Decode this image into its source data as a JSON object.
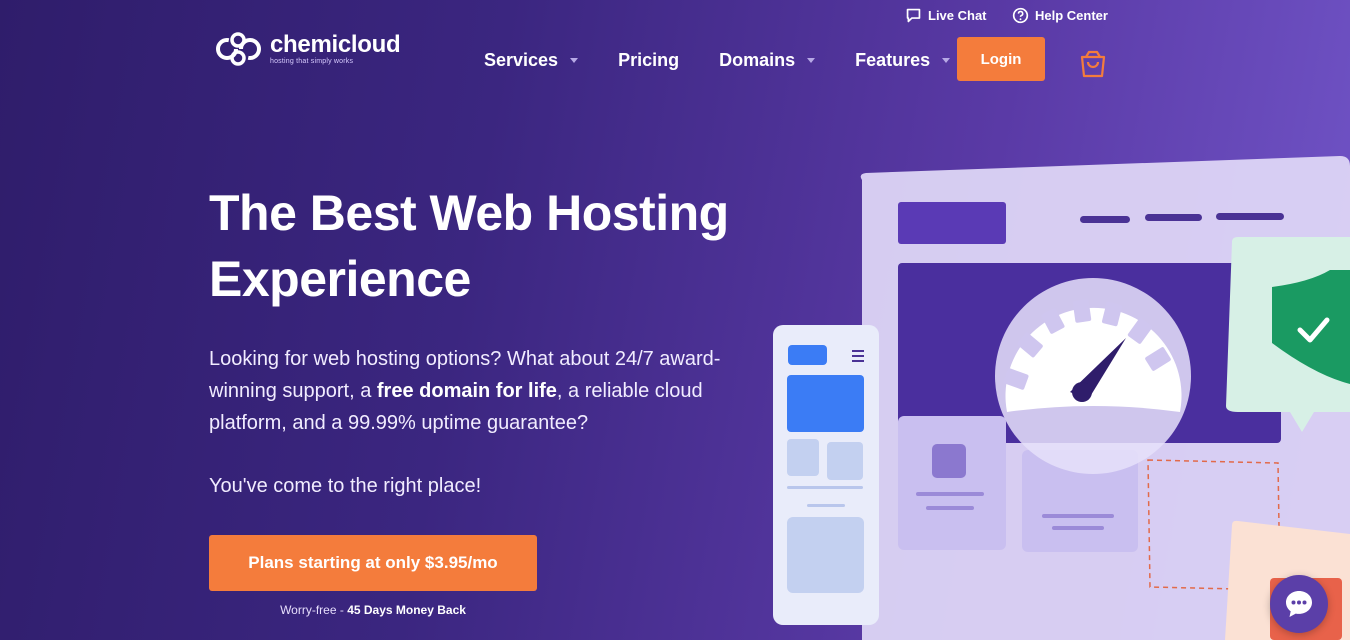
{
  "utility": {
    "live_chat": "Live Chat",
    "help_center": "Help Center"
  },
  "logo": {
    "name": "chemicloud",
    "tagline": "hosting that simply works"
  },
  "nav": {
    "items": [
      {
        "label": "Services",
        "has_dropdown": true
      },
      {
        "label": "Pricing",
        "has_dropdown": false
      },
      {
        "label": "Domains",
        "has_dropdown": true
      },
      {
        "label": "Features",
        "has_dropdown": true
      }
    ],
    "login_label": "Login"
  },
  "hero": {
    "title": "The Best Web Hosting Experience",
    "desc_part1": "Looking for web hosting options? What about 24/7 award-winning support, a ",
    "desc_bold": "free domain for life",
    "desc_part2": ", a reliable cloud platform, and a 99.99% uptime guarantee?",
    "sub": "You've come to the right place!",
    "cta_label": "Plans starting at only $3.95/mo",
    "guarantee_prefix": "Worry-free - ",
    "guarantee_bold": "45 Days Money Back"
  },
  "colors": {
    "accent": "#f47c3c",
    "bg_dark": "#2f1d6b",
    "bg_light": "#7256c9"
  },
  "icons": [
    "live-chat-icon",
    "help-icon",
    "logo-icon",
    "cart-icon",
    "chat-bubble-icon"
  ]
}
